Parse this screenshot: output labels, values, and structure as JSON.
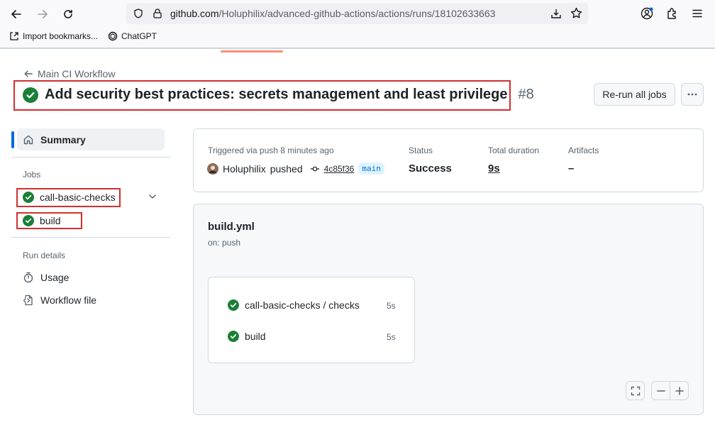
{
  "browser": {
    "url_host": "github.com",
    "url_path": "/Holuphilix/advanced-github-actions/actions/runs/18102633663",
    "bookmarks": [
      "Import bookmarks...",
      "ChatGPT"
    ]
  },
  "header": {
    "back_label": "Main CI Workflow",
    "title": "Add security best practices: secrets management and least privilege",
    "run_number": "#8",
    "rerun_label": "Re-run all jobs"
  },
  "sidebar": {
    "summary_label": "Summary",
    "jobs_heading": "Jobs",
    "jobs": [
      "call-basic-checks",
      "build"
    ],
    "run_details_heading": "Run details",
    "usage_label": "Usage",
    "workflow_file_label": "Workflow file"
  },
  "info": {
    "trigger_text": "Triggered via push 8 minutes ago",
    "actor": "Holuphilix",
    "action": "pushed",
    "commit_sha": "4c85f36",
    "branch": "main",
    "status_label": "Status",
    "status_value": "Success",
    "duration_label": "Total duration",
    "duration_value": "9s",
    "artifacts_label": "Artifacts",
    "artifacts_value": "–"
  },
  "graph": {
    "workflow_name": "build.yml",
    "trigger": "on: push",
    "jobs": [
      {
        "name": "call-basic-checks / checks",
        "duration": "5s"
      },
      {
        "name": "build",
        "duration": "5s"
      }
    ]
  },
  "colors": {
    "success": "#1a7f37",
    "accent": "#0969da",
    "highlight": "#d32f2f"
  }
}
